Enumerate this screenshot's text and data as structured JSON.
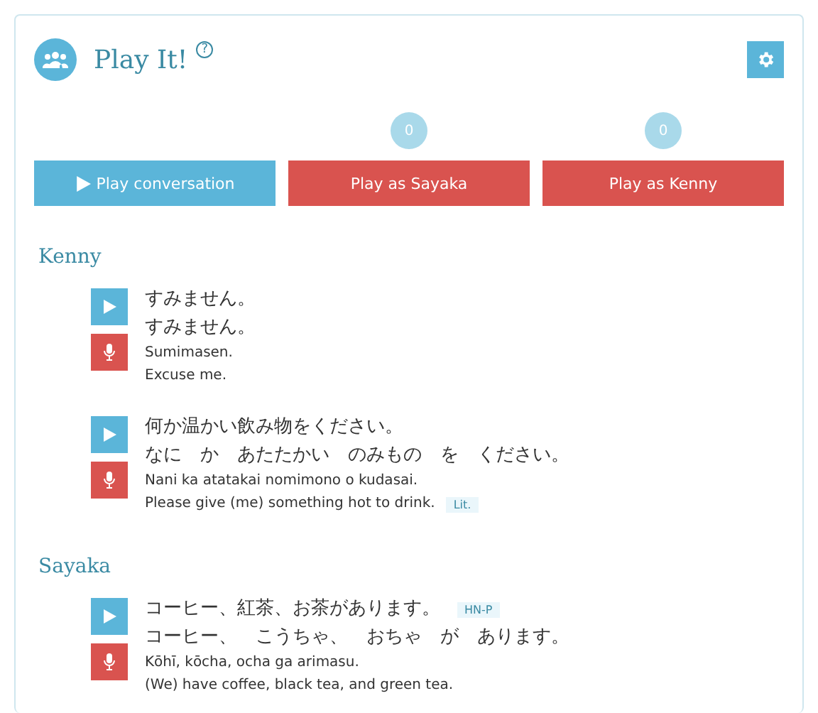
{
  "header": {
    "title": "Play It!",
    "help": "?"
  },
  "buttons": [
    {
      "kind": "conversation",
      "label": "Play conversation"
    },
    {
      "kind": "role",
      "label": "Play as Sayaka",
      "count": "0"
    },
    {
      "kind": "role",
      "label": "Play as Kenny",
      "count": "0"
    }
  ],
  "sections": [
    {
      "speaker": "Kenny",
      "lines": [
        {
          "japanese": "すみません。",
          "reading": "すみません。",
          "romaji": "Sumimasen.",
          "english": "Excuse me."
        },
        {
          "japanese": "何か温かい飲み物をください。",
          "reading": "なに　か　あたたかい　のみもの　を　ください。",
          "romaji": "Nani ka atatakai nomimono o kudasai.",
          "english": "Please give (me) something hot to drink.",
          "english_tag": "Lit."
        }
      ]
    },
    {
      "speaker": "Sayaka",
      "lines": [
        {
          "japanese": "コーヒー、紅茶、お茶があります。",
          "japanese_tag": "HN-P",
          "reading": "コーヒー、　こうちゃ、　おちゃ　が　あります。",
          "romaji": "Kōhī, kōcha, ocha ga arimasu.",
          "english": "(We) have coffee, black tea, and green tea."
        }
      ]
    }
  ]
}
